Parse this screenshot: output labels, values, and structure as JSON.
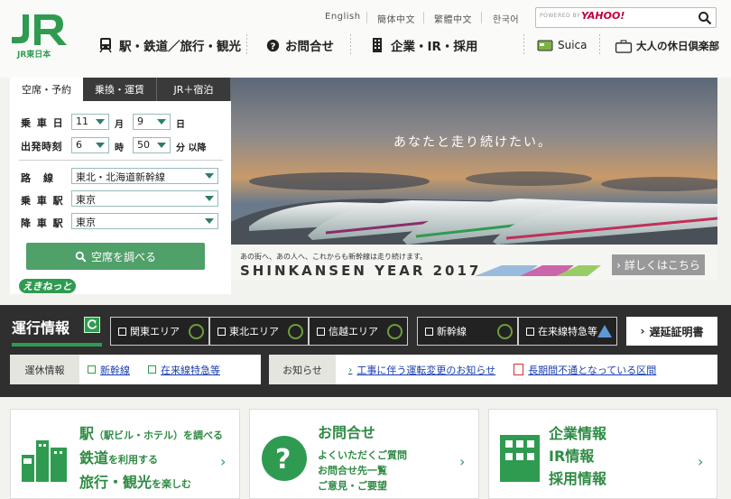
{
  "header": {
    "logo_text": "JR東日本",
    "languages": [
      "English",
      "簡体中文",
      "繁體中文",
      "한국어"
    ],
    "search": {
      "powered": "POWERED BY",
      "brand": "YAHOO!"
    },
    "nav": [
      "駅・鉄道／旅行・観光",
      "お問合せ",
      "企業・IR・採用"
    ],
    "subnav": [
      "Suica",
      "大人の休日倶楽部"
    ]
  },
  "booking": {
    "tabs": [
      "空席・予約",
      "乗換・運賃",
      "JR＋宿泊"
    ],
    "date_label": "乗 車 日",
    "month": "11",
    "month_unit": "月",
    "day": "9",
    "day_unit": "日",
    "time_label": "出発時刻",
    "hour": "6",
    "hour_unit": "時",
    "minute": "50",
    "minute_unit": "分 以降",
    "route_label": "路　線",
    "route": "東北・北海道新幹線",
    "from_label": "乗 車 駅",
    "from": "東京",
    "to_label": "降 車 駅",
    "to": "東京",
    "search_button": "空席を調べる",
    "ekinet": "えきねっと"
  },
  "hero": {
    "tagline": "あなたと走り続けたい。",
    "small": "あの街へ、あの人へ、これからも新幹線は走り続けます。",
    "title": "SHINKANSEN YEAR 2017",
    "detail_button": "詳しくはこちら"
  },
  "operations": {
    "title": "運行情報",
    "areas": [
      "関東エリア",
      "東北エリア",
      "信越エリア",
      "新幹線",
      "在来線特急等"
    ],
    "delay_button": "遅延証明書",
    "suspension_label": "運休情報",
    "suspension_links": [
      "新幹線",
      "在来線特急等"
    ],
    "notice_label": "お知らせ",
    "notice_links": [
      "工事に伴う運転変更のお知らせ",
      "長期間不通となっている区間"
    ]
  },
  "cards": {
    "station": {
      "lines": [
        "駅",
        "（駅ビル・ホテル）を調べる",
        "鉄道",
        "を利用する",
        "旅行・観光",
        "を楽しむ"
      ]
    },
    "contact": {
      "title": "お問合せ",
      "lines": [
        "よくいただくご質問",
        "お問合せ先一覧",
        "ご意見・ご要望"
      ]
    },
    "corporate": {
      "lines": [
        "企業情報",
        "IR情報",
        "採用情報"
      ]
    }
  },
  "colors": {
    "brand_green": "#2f9b51",
    "dark_bar": "#2f2f2f",
    "link_blue": "#1a3eb0"
  }
}
